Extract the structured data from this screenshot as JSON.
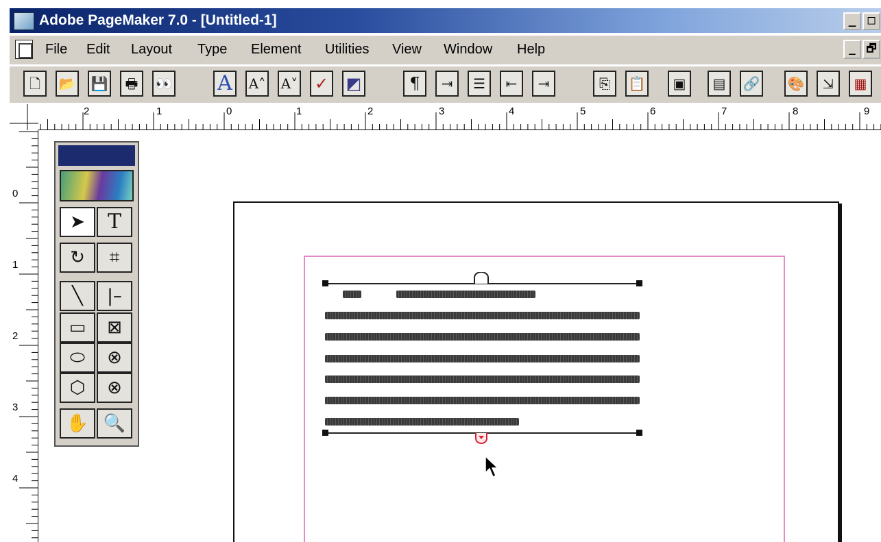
{
  "window": {
    "title": "Adobe PageMaker 7.0 - [Untitled-1]",
    "controls": [
      "_",
      "□"
    ]
  },
  "menubar": {
    "items": [
      "File",
      "Edit",
      "Layout",
      "Type",
      "Element",
      "Utilities",
      "View",
      "Window",
      "Help"
    ],
    "doc_controls": [
      "_",
      "🗗"
    ]
  },
  "toolbar": {
    "buttons": [
      {
        "name": "new-document-icon",
        "glyph": "🗋"
      },
      {
        "name": "open-icon",
        "glyph": "📂"
      },
      {
        "name": "save-icon",
        "glyph": "💾"
      },
      {
        "name": "print-icon",
        "glyph": "🖶"
      },
      {
        "name": "find-icon",
        "glyph": "👀"
      },
      {
        "name": "character-format-icon",
        "glyph": "A"
      },
      {
        "name": "increase-font-size-icon",
        "glyph": "A˄"
      },
      {
        "name": "decrease-font-size-icon",
        "glyph": "A˅"
      },
      {
        "name": "spelling-icon",
        "glyph": "✓"
      },
      {
        "name": "fill-stroke-icon",
        "glyph": "◩"
      },
      {
        "name": "paragraph-icon",
        "glyph": "¶"
      },
      {
        "name": "indents-tabs-icon",
        "glyph": "⇥"
      },
      {
        "name": "bullets-icon",
        "glyph": "☰"
      },
      {
        "name": "decrease-indent-icon",
        "glyph": "⇤"
      },
      {
        "name": "increase-indent-icon",
        "glyph": "⇥"
      },
      {
        "name": "copy-icon",
        "glyph": "⎘"
      },
      {
        "name": "paste-icon",
        "glyph": "📋"
      },
      {
        "name": "place-icon",
        "glyph": "▣"
      },
      {
        "name": "image-frame-icon",
        "glyph": "▤"
      },
      {
        "name": "links-icon",
        "glyph": "🔗"
      },
      {
        "name": "color-palette-icon",
        "glyph": "🎨"
      },
      {
        "name": "export-icon",
        "glyph": "⇲"
      },
      {
        "name": "master-pages-icon",
        "glyph": "▦"
      }
    ]
  },
  "rulers": {
    "horizontal": [
      "2",
      "1",
      "0",
      "1",
      "2",
      "3",
      "4",
      "5",
      "6",
      "7",
      "8",
      "9"
    ],
    "vertical": [
      "0",
      "1",
      "2",
      "3",
      "4"
    ]
  },
  "toolbox": {
    "tools": [
      {
        "name": "pointer-tool-icon",
        "glyph": "➤",
        "selected": true
      },
      {
        "name": "text-tool-icon",
        "glyph": "T",
        "selected": false
      },
      {
        "name": "rotate-tool-icon",
        "glyph": "↻",
        "selected": false
      },
      {
        "name": "crop-tool-icon",
        "glyph": "⌗",
        "selected": false
      },
      {
        "name": "line-tool-icon",
        "glyph": "╲",
        "selected": false
      },
      {
        "name": "constrained-line-tool-icon",
        "glyph": "|–",
        "selected": false
      },
      {
        "name": "rectangle-tool-icon",
        "glyph": "▭",
        "selected": false
      },
      {
        "name": "rectangle-frame-tool-icon",
        "glyph": "⊠",
        "selected": false
      },
      {
        "name": "ellipse-tool-icon",
        "glyph": "⬭",
        "selected": false
      },
      {
        "name": "ellipse-frame-tool-icon",
        "glyph": "⊗",
        "selected": false
      },
      {
        "name": "polygon-tool-icon",
        "glyph": "⬡",
        "selected": false
      },
      {
        "name": "polygon-frame-tool-icon",
        "glyph": "⊗",
        "selected": false
      },
      {
        "name": "hand-tool-icon",
        "glyph": "✋",
        "selected": false
      },
      {
        "name": "zoom-tool-icon",
        "glyph": "🔍",
        "selected": false
      }
    ]
  }
}
